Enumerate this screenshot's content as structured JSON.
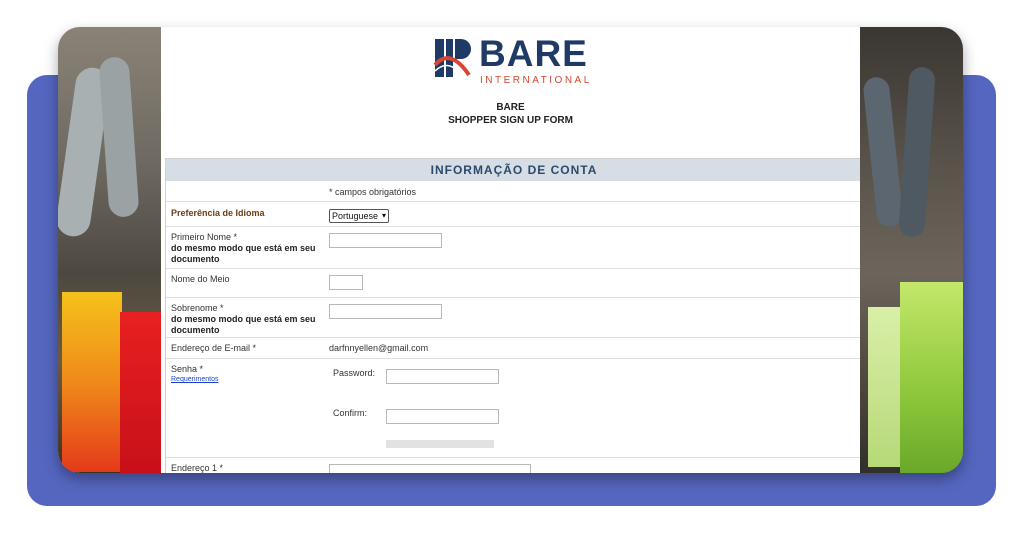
{
  "brand": {
    "word": "BARE",
    "sub": "INTERNATIONAL"
  },
  "header": {
    "line1": "BARE",
    "line2": "SHOPPER SIGN UP FORM"
  },
  "section": {
    "title": "INFORMAÇÃO DE CONTA",
    "required_note": "* campos obrigatórios"
  },
  "fields": {
    "language": {
      "label": "Preferência de Idioma",
      "selected": "Portuguese"
    },
    "first_name": {
      "label": "Primeiro Nome *",
      "hint": "do mesmo modo que está em seu documento"
    },
    "middle_name": {
      "label": "Nome do Meio"
    },
    "last_name": {
      "label": "Sobrenome *",
      "hint": "do mesmo modo que está em seu documento"
    },
    "email": {
      "label": "Endereço de E-mail *",
      "value": "darfnnyellen@gmail.com"
    },
    "password": {
      "label": "Senha *",
      "link": "Requerimentos",
      "password_label": "Password:",
      "confirm_label": "Confirm:"
    },
    "address1": {
      "label": "Endereço 1 *"
    }
  },
  "colors": {
    "slab": "#5566c0",
    "header_bg": "#d7dde4",
    "header_text": "#2b4a6b",
    "logo_blue": "#1f3a66",
    "logo_red": "#d9462f",
    "label_brown": "#6b3d10"
  }
}
